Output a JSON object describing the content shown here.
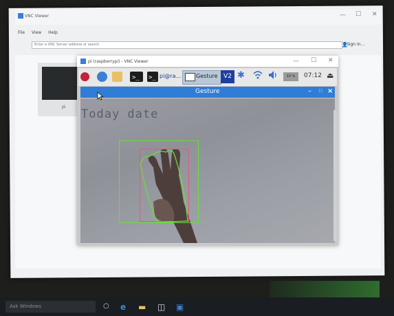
{
  "vnc_viewer": {
    "window_title": "VNC Viewer",
    "menu": [
      "File",
      "View",
      "Help"
    ],
    "address_placeholder": "Enter a VNC Server address or search",
    "sign_in_label": "Sign in..."
  },
  "thumbnail": {
    "label": "pi"
  },
  "pi_window": {
    "title": "pi (raspberrypi) - VNC Viewer"
  },
  "pi_taskbar": {
    "pi_label": "pi@ra...",
    "gesture_label": "Gesture",
    "vnc_label": "V2",
    "cpu": "10 %",
    "clock": "07:12"
  },
  "gesture_window": {
    "title": "Gesture",
    "overlay_text": "Today date"
  },
  "windows_taskbar": {
    "search_placeholder": "Ask Windows"
  },
  "icons": [
    "raspberry-icon",
    "globe-icon",
    "folder-icon",
    "terminal-icon",
    "bluetooth-icon",
    "wifi-icon",
    "volume-icon",
    "eject-icon",
    "user-icon"
  ],
  "colors": {
    "gesture_titlebar": "#2f7dd6",
    "bounding_box_green": "#6bdc3a",
    "bounding_box_pink": "#e05a7a"
  }
}
